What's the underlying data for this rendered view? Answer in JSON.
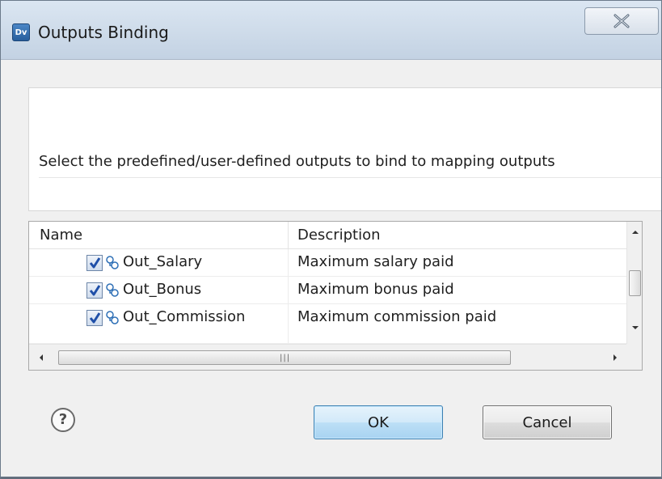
{
  "window": {
    "title": "Outputs Binding",
    "app_icon_text": "Dv"
  },
  "header": {
    "message": "Select the predefined/user-defined outputs to bind to mapping outputs"
  },
  "table": {
    "columns": [
      "Name",
      "Description"
    ],
    "rows": [
      {
        "name": "Out_Salary",
        "description": "Maximum salary paid",
        "checked": true
      },
      {
        "name": "Out_Bonus",
        "description": "Maximum bonus paid",
        "checked": true
      },
      {
        "name": "Out_Commission",
        "description": "Maximum commission paid",
        "checked": true
      }
    ]
  },
  "buttons": {
    "ok_label": "OK",
    "cancel_label": "Cancel"
  },
  "icons": {
    "help": "question-mark-icon",
    "close": "close-icon",
    "variable": "variable-icon",
    "checkbox": "checkmark-icon"
  },
  "colors": {
    "ok_border": "#3c7fb1",
    "check_blue": "#1f4fa8",
    "variable_blue": "#2e6fb6"
  }
}
